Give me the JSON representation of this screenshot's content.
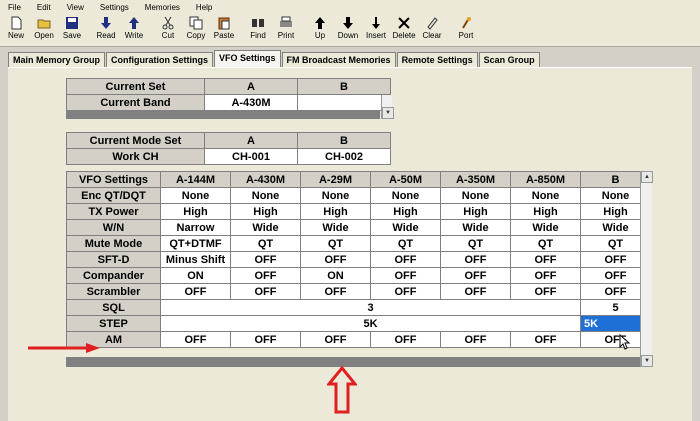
{
  "menu": [
    "File",
    "Edit",
    "View",
    "Settings",
    "Memories",
    "Help"
  ],
  "toolbar": [
    {
      "label": "New",
      "icon": "new-file-icon"
    },
    {
      "label": "Open",
      "icon": "open-folder-icon"
    },
    {
      "label": "Save",
      "icon": "save-icon"
    },
    {
      "label": "Read",
      "icon": "read-arrow-down-icon"
    },
    {
      "label": "Write",
      "icon": "write-arrow-up-icon"
    },
    {
      "label": "Cut",
      "icon": "cut-icon"
    },
    {
      "label": "Copy",
      "icon": "copy-icon"
    },
    {
      "label": "Paste",
      "icon": "paste-icon"
    },
    {
      "label": "Find",
      "icon": "find-icon"
    },
    {
      "label": "Print",
      "icon": "print-icon"
    },
    {
      "label": "Up",
      "icon": "up-arrow-icon"
    },
    {
      "label": "Down",
      "icon": "down-arrow-icon"
    },
    {
      "label": "Insert",
      "icon": "insert-arrow-icon"
    },
    {
      "label": "Delete",
      "icon": "delete-x-icon"
    },
    {
      "label": "Clear",
      "icon": "clear-eraser-icon"
    },
    {
      "label": "Port",
      "icon": "port-icon"
    }
  ],
  "tabs": [
    "Main Memory Group",
    "Configuration Settings",
    "VFO Settings",
    "FM Broadcast Memories",
    "Remote Settings",
    "Scan Group"
  ],
  "active_tab": "VFO Settings",
  "current_set": {
    "headers": [
      "Current Set",
      "A",
      "B"
    ],
    "rows": [
      [
        "Current Band",
        "A-430M",
        ""
      ]
    ]
  },
  "current_mode": {
    "headers": [
      "Current Mode Set",
      "A",
      "B"
    ],
    "rows": [
      [
        "Work CH",
        "CH-001",
        "CH-002"
      ]
    ]
  },
  "vfo": {
    "headers": [
      "VFO Settings",
      "A-144M",
      "A-430M",
      "A-29M",
      "A-50M",
      "A-350M",
      "A-850M",
      "B"
    ],
    "rows": [
      [
        "Enc QT/DQT",
        "None",
        "None",
        "None",
        "None",
        "None",
        "None",
        "None"
      ],
      [
        "TX Power",
        "High",
        "High",
        "High",
        "High",
        "High",
        "High",
        "High"
      ],
      [
        "W/N",
        "Narrow",
        "Wide",
        "Wide",
        "Wide",
        "Wide",
        "Wide",
        "Wide"
      ],
      [
        "Mute Mode",
        "QT+DTMF",
        "QT",
        "QT",
        "QT",
        "QT",
        "QT",
        "QT"
      ],
      [
        "SFT-D",
        "Minus Shift",
        "OFF",
        "OFF",
        "OFF",
        "OFF",
        "OFF",
        "OFF"
      ],
      [
        "Compander",
        "ON",
        "OFF",
        "ON",
        "OFF",
        "OFF",
        "OFF",
        "OFF"
      ],
      [
        "Scrambler",
        "OFF",
        "OFF",
        "OFF",
        "OFF",
        "OFF",
        "OFF",
        "OFF"
      ]
    ],
    "sql": {
      "label": "SQL",
      "a": "3",
      "b": "5"
    },
    "step": {
      "label": "STEP",
      "a": "5K",
      "b": "5K"
    },
    "am": [
      "AM",
      "OFF",
      "OFF",
      "OFF",
      "OFF",
      "OFF",
      "OFF",
      "OFF"
    ]
  },
  "annotations": {
    "arrow_color": "#e02020"
  }
}
